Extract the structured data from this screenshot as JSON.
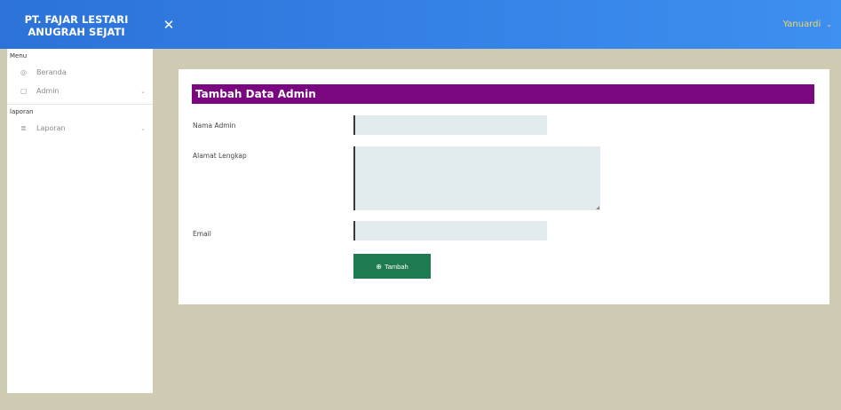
{
  "brand": {
    "line1": "PT. FAJAR LESTARI",
    "line2": "ANUGRAH SEJATI"
  },
  "topbar": {
    "toggle_icon": "✕",
    "user_name": "Yanuardi",
    "user_caret": "⌄"
  },
  "sidebar": {
    "section_menu": "Menu",
    "items_menu": [
      {
        "icon": "◎",
        "label": "Beranda",
        "chevron": ""
      },
      {
        "icon": "▢",
        "label": "Admin",
        "chevron": "⌄"
      }
    ],
    "section_laporan": "laporan",
    "items_laporan": [
      {
        "icon": "≣",
        "label": "Laporan",
        "chevron": "⌄"
      }
    ]
  },
  "form": {
    "title": "Tambah Data Admin",
    "fields": {
      "nama_label": "Nama Admin",
      "nama_value": "",
      "alamat_label": "Alamat Lengkap",
      "alamat_value": "",
      "email_label": "Email",
      "email_value": ""
    },
    "submit_icon": "⊕",
    "submit_label": "Tambah"
  }
}
